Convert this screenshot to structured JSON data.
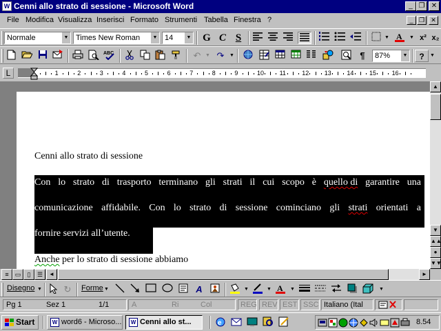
{
  "window": {
    "title": "Cenni allo strato di sessione - Microsoft Word",
    "app_icon_letter": "W"
  },
  "menu": [
    "File",
    "Modifica",
    "Visualizza",
    "Inserisci",
    "Formato",
    "Strumenti",
    "Tabella",
    "Finestra",
    "?"
  ],
  "formatting": {
    "style": "Normale",
    "font": "Times New Roman",
    "size": "14",
    "bold_label": "G",
    "italic_label": "C",
    "underline_label": "S"
  },
  "standard": {
    "zoom": "87%"
  },
  "ruler": {
    "numbers": [
      "1",
      "2",
      "3",
      "4",
      "5",
      "6",
      "7",
      "8",
      "9",
      "10",
      "11",
      "12",
      "13",
      "14",
      "15",
      "16"
    ],
    "vertical_numbers": [
      "2",
      "1",
      "1",
      "2",
      "3",
      "4",
      "5"
    ]
  },
  "document": {
    "heading": "Cenni allo strato di sessione",
    "para_line1": [
      "Con",
      "lo",
      "strato",
      "di",
      "trasporto",
      "terminano",
      "gli",
      "strati",
      "il",
      "cui",
      "scopo",
      "è",
      "quello di",
      "garantire",
      "una"
    ],
    "para_line2": [
      "comunicazione",
      "affidabile.",
      "Con",
      "lo",
      "strato",
      "di",
      "sessione",
      "cominciano",
      "gli",
      "strati",
      "orientati",
      "a"
    ],
    "para_line3": "fornire servizi all’utente.",
    "line4_first": "Anche",
    "line4_rest": " per lo strato di sessione abbiamo"
  },
  "drawing": {
    "draw_label": "Disegno",
    "shapes_label": "Forme"
  },
  "status": {
    "page": "Pg 1",
    "section": "Sez 1",
    "pages": "1/1",
    "at": "A",
    "line": "Ri",
    "col": "Col",
    "rec": "REG",
    "trk": "REV",
    "ext": "EST",
    "ovr": "SSC",
    "language": "Italiano (Ital"
  },
  "taskbar": {
    "start": "Start",
    "tasks": [
      "word6 - Microso...",
      "Cenni allo st..."
    ],
    "clock": "8.54"
  },
  "colors": {
    "titlebar": "#000080",
    "face": "#c0c0c0",
    "selection": "#000000",
    "spell_error": "#e00000",
    "grammar_error": "#00a000"
  }
}
